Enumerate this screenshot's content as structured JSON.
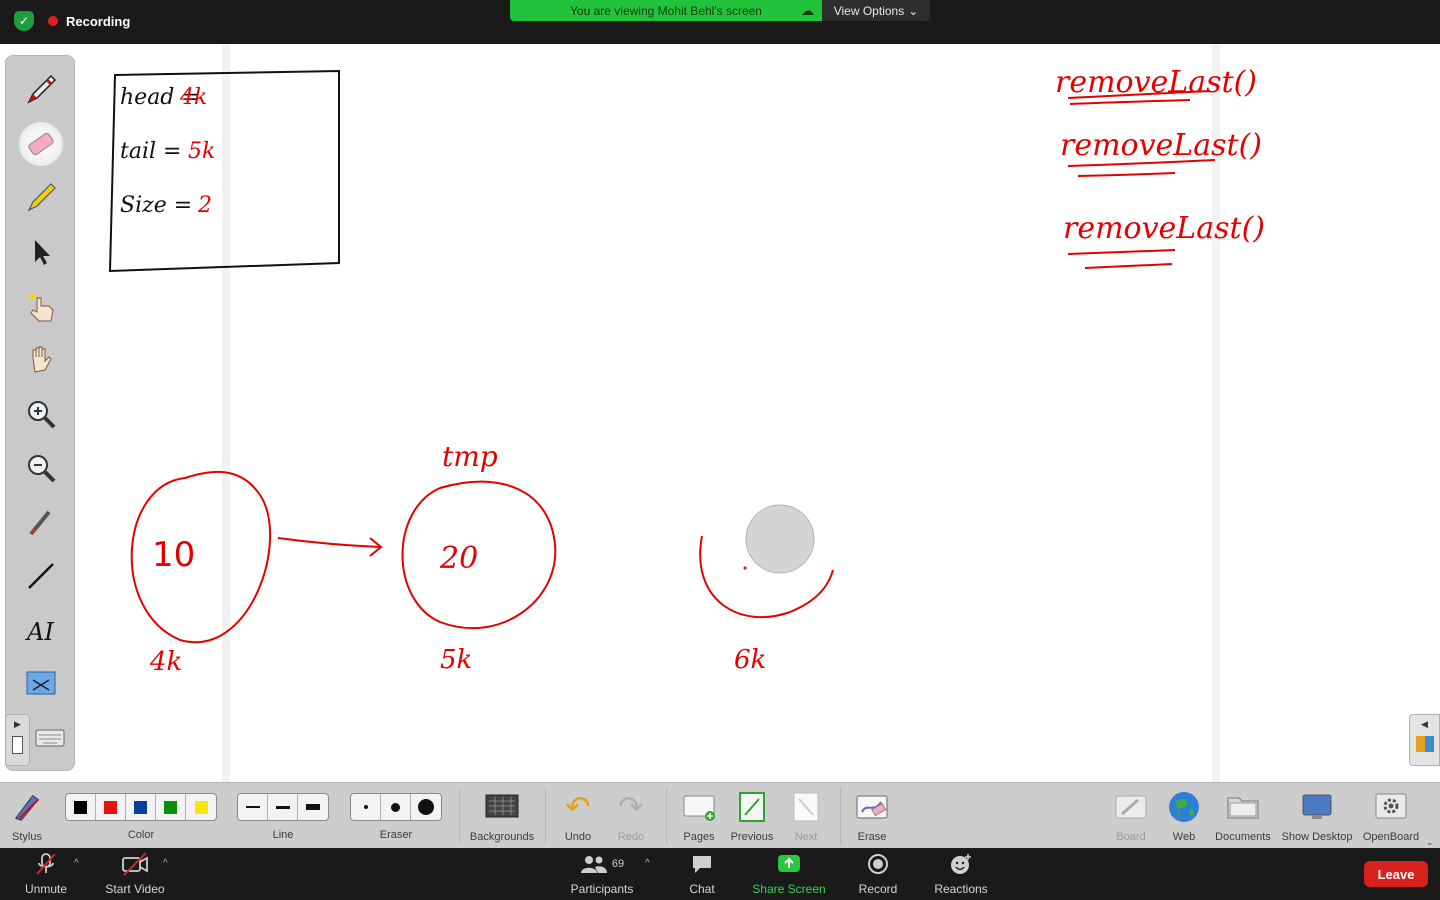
{
  "recording": {
    "label": "Recording"
  },
  "banner": {
    "viewing_text": "You are viewing Mohit Behl's screen",
    "view_options": "View Options"
  },
  "whiteboard": {
    "box_lines": [
      {
        "key": "head =",
        "value": "4k"
      },
      {
        "key": "tail =",
        "value": "5k"
      },
      {
        "key": "Size =",
        "value": "2"
      }
    ],
    "notes": [
      "removeLast()",
      "removeLast()",
      "removeLast()"
    ],
    "nodes": [
      {
        "value": "10",
        "address": "4k"
      },
      {
        "value": "20",
        "address": "5k",
        "pointer": "tmp"
      },
      {
        "value": "",
        "address": "6k"
      }
    ]
  },
  "ob_toolbar": {
    "stylus": "Stylus",
    "color": "Color",
    "colors": [
      "#000000",
      "#e8130f",
      "#0b3fa0",
      "#0b8f0b",
      "#f7e50c"
    ],
    "line": "Line",
    "eraser": "Eraser",
    "backgrounds": "Backgrounds",
    "undo": "Undo",
    "redo": "Redo",
    "pages": "Pages",
    "previous": "Previous",
    "next": "Next",
    "erase": "Erase",
    "board": "Board",
    "web": "Web",
    "documents": "Documents",
    "show_desktop": "Show Desktop",
    "openboard": "OpenBoard"
  },
  "zoom_toolbar": {
    "unmute": "Unmute",
    "start_video": "Start Video",
    "participants": "Participants",
    "participant_count": "69",
    "chat": "Chat",
    "share_screen": "Share Screen",
    "record": "Record",
    "reactions": "Reactions",
    "leave": "Leave"
  }
}
